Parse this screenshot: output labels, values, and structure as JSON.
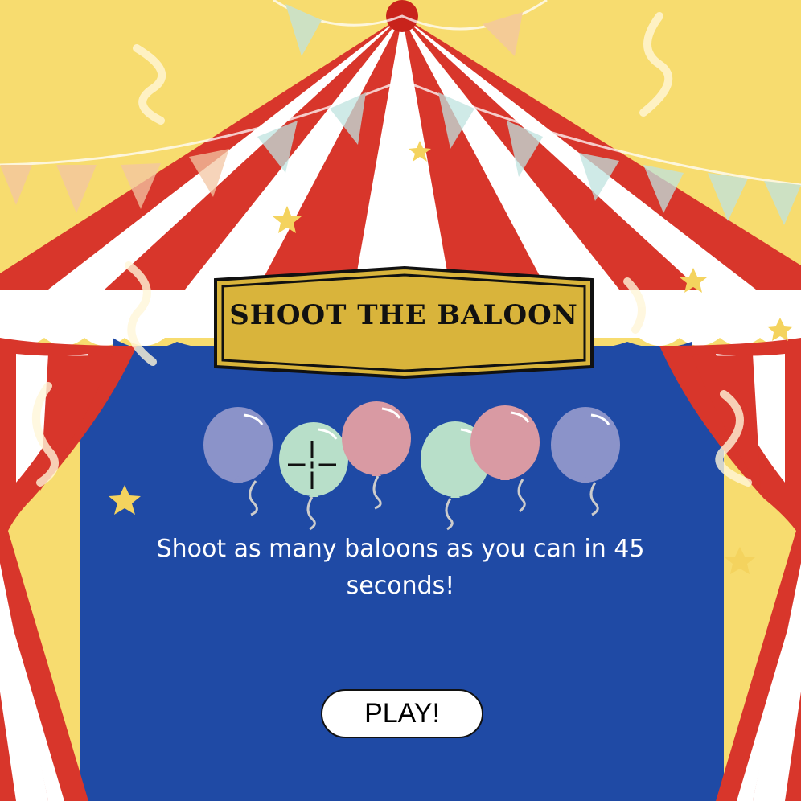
{
  "game": {
    "title": "SHOOT THE BALOON",
    "instructions": "Shoot as many baloons as you can in 45 seconds!",
    "play_label": "PLAY!"
  },
  "balloons": [
    {
      "color": "#8b93c9"
    },
    {
      "color": "#b8dfc9"
    },
    {
      "color": "#d99aa3"
    },
    {
      "color": "#b8dfc9"
    },
    {
      "color": "#d99aa3"
    },
    {
      "color": "#8b93c9"
    }
  ],
  "theme": {
    "stage_blue": "#1f4aa5",
    "tent_red": "#d8362b",
    "sky_yellow": "#f7dc6f",
    "sign_gold": "#d9b43b"
  },
  "icons": [
    "crosshair-icon",
    "star-icon",
    "pennant-flag"
  ]
}
